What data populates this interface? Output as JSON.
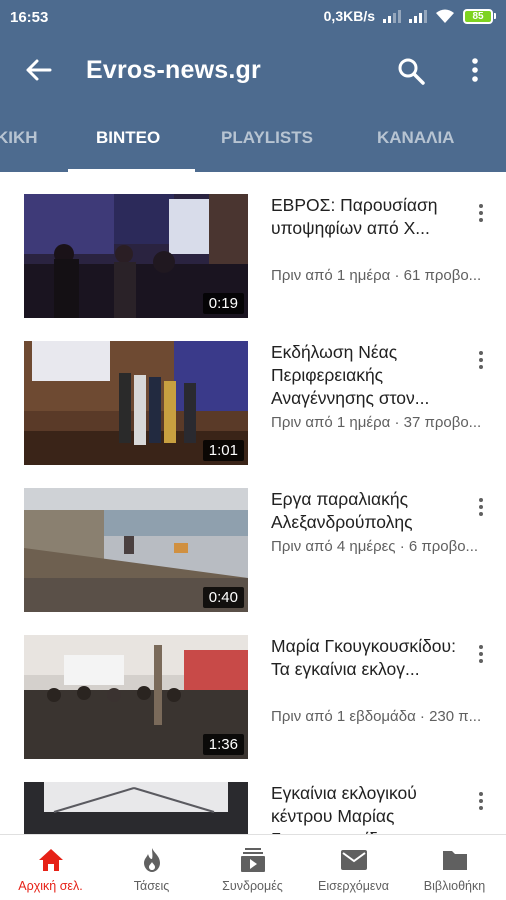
{
  "status_bar": {
    "time": "16:53",
    "network_speed": "0,3KB/s",
    "battery": "85",
    "icons": [
      "signal-icon",
      "signal-icon",
      "wifi-icon",
      "battery-icon"
    ]
  },
  "app_bar": {
    "title": "Evros-news.gr",
    "back_icon": "arrow-left-icon",
    "search_icon": "search-icon",
    "more_icon": "more-vertical-icon"
  },
  "tabs": [
    {
      "label": "ΚΙΚΗ",
      "active": false
    },
    {
      "label": "ΒΙΝΤΕΟ",
      "active": true
    },
    {
      "label": "PLAYLISTS",
      "active": false
    },
    {
      "label": "ΚΑΝΑΛΙΑ",
      "active": false
    }
  ],
  "videos": [
    {
      "title": "ΕΒΡΟΣ: Παρουσίαση υποψηφίων από Χ...",
      "meta": "Πριν από 1 ημέρα · 61 προβο...",
      "duration": "0:19"
    },
    {
      "title": "Εκδήλωση Νέας Περιφερειακής Αναγέννησης στον...",
      "meta": "Πριν από 1 ημέρα · 37 προβο...",
      "duration": "1:01"
    },
    {
      "title": "Εργα παραλιακής Αλεξανδρούπολης",
      "meta": "Πριν από 4 ημέρες · 6 προβο...",
      "duration": "0:40"
    },
    {
      "title": "Μαρία Γκουγκουσκίδου: Τα εγκαίνια εκλογ...",
      "meta": "Πριν από 1 εβδομάδα · 230 π...",
      "duration": "1:36"
    },
    {
      "title": "Εγκαίνια εκλογικού κέντρου Μαρίας Γκουγκουσκίδου",
      "meta": "",
      "duration": ""
    }
  ],
  "bottom_nav": [
    {
      "label": "Αρχική σελ.",
      "icon": "home-icon",
      "active": true
    },
    {
      "label": "Τάσεις",
      "icon": "fire-icon",
      "active": false
    },
    {
      "label": "Συνδρομές",
      "icon": "subscriptions-icon",
      "active": false
    },
    {
      "label": "Εισερχόμενα",
      "icon": "mail-icon",
      "active": false
    },
    {
      "label": "Βιβλιοθήκη",
      "icon": "folder-icon",
      "active": false
    }
  ],
  "colors": {
    "header": "#4d6b8f",
    "active_nav": "#e62117",
    "battery": "#7ed321"
  }
}
